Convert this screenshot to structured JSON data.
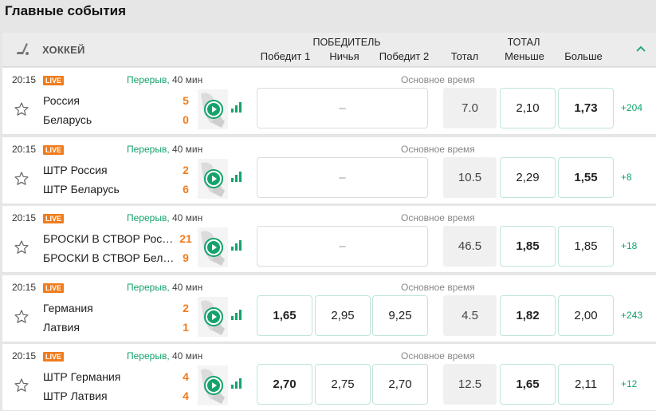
{
  "page": {
    "title": "Главные события"
  },
  "header": {
    "sport": "ХОККЕЙ",
    "sport_icon": "hockey-stick-icon",
    "winner_group": "ПОБЕДИТЕЛЬ",
    "total_group": "ТОТАЛ",
    "columns": {
      "w1": "Победит 1",
      "draw": "Ничья",
      "w2": "Победит 2",
      "total": "Тотал",
      "under": "Меньше",
      "over": "Больше"
    },
    "collapse_icon": "chevron-up-icon"
  },
  "colors": {
    "accent": "#14a36b",
    "live": "#f07c1c",
    "score": "#f07c1c"
  },
  "events": [
    {
      "time": "20:15",
      "live": "LIVE",
      "status": "Перерыв,",
      "minutes": "40 мин",
      "period": "Основное время",
      "team1": "Россия",
      "team2": "Беларусь",
      "score1": "5",
      "score2": "0",
      "w1": "",
      "draw": "–",
      "w2": "",
      "total": "7.0",
      "under": "2,10",
      "over": "1,73",
      "more": "+204"
    },
    {
      "time": "20:15",
      "live": "LIVE",
      "status": "Перерыв,",
      "minutes": "40 мин",
      "period": "Основное время",
      "team1": "ШТР Россия",
      "team2": "ШТР Беларусь",
      "score1": "2",
      "score2": "6",
      "w1": "",
      "draw": "–",
      "w2": "",
      "total": "10.5",
      "under": "2,29",
      "over": "1,55",
      "more": "+8"
    },
    {
      "time": "20:15",
      "live": "LIVE",
      "status": "Перерыв,",
      "minutes": "40 мин",
      "period": "Основное время",
      "team1": "БРОСКИ В СТВОР Рос…",
      "team2": "БРОСКИ В СТВОР Бел…",
      "score1": "21",
      "score2": "9",
      "w1": "",
      "draw": "–",
      "w2": "",
      "total": "46.5",
      "under": "1,85",
      "over": "1,85",
      "more": "+18"
    },
    {
      "time": "20:15",
      "live": "LIVE",
      "status": "Перерыв,",
      "minutes": "40 мин",
      "period": "Основное время",
      "team1": "Германия",
      "team2": "Латвия",
      "score1": "2",
      "score2": "1",
      "w1": "1,65",
      "draw": "2,95",
      "w2": "9,25",
      "total": "4.5",
      "under": "1,82",
      "over": "2,00",
      "more": "+243"
    },
    {
      "time": "20:15",
      "live": "LIVE",
      "status": "Перерыв,",
      "minutes": "40 мин",
      "period": "Основное время",
      "team1": "ШТР Германия",
      "team2": "ШТР Латвия",
      "score1": "4",
      "score2": "4",
      "w1": "2,70",
      "draw": "2,75",
      "w2": "2,70",
      "total": "12.5",
      "under": "1,65",
      "over": "2,11",
      "more": "+12"
    }
  ]
}
